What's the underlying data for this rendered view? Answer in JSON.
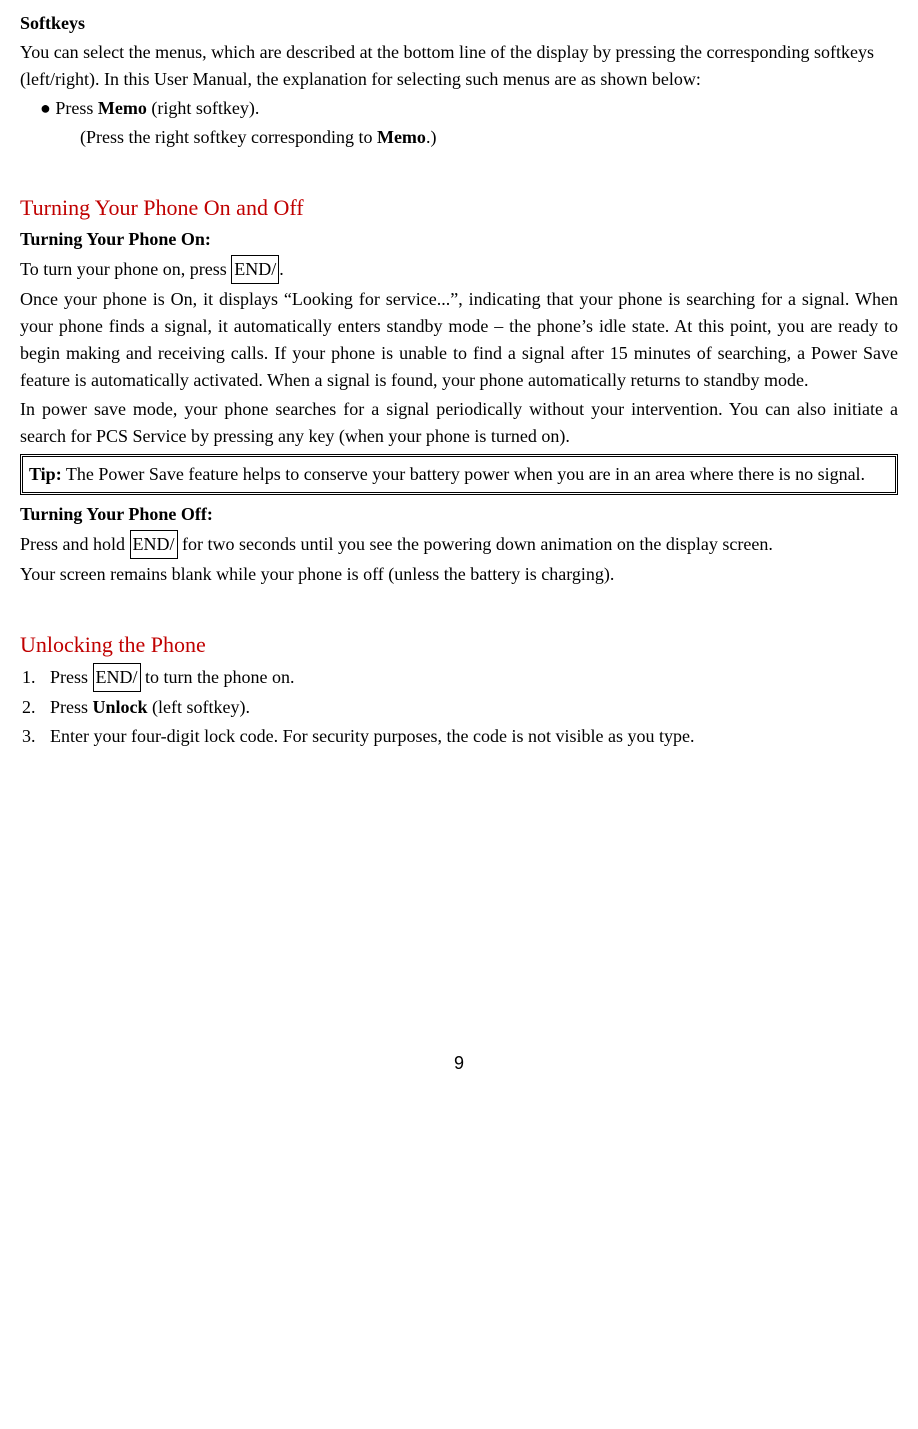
{
  "softkeys": {
    "heading": "Softkeys",
    "body": "You can select the menus, which are described at the bottom line of the display by pressing the corresponding softkeys (left/right). In this User Manual, the explanation for selecting such menus are as shown below:",
    "bullet_pre": "Press ",
    "bullet_bold": "Memo",
    "bullet_post": " (right softkey).",
    "subline_pre": "(Press the right softkey corresponding to ",
    "subline_bold": "Memo",
    "subline_post": ".)"
  },
  "turning": {
    "heading": "Turning Your Phone On and Off",
    "on_heading": "Turning Your Phone On:",
    "on_line1_pre": "To turn your phone on, press ",
    "on_line1_key": "END/",
    "on_line1_post": ".",
    "on_para1": "Once your phone is On, it displays “Looking for service...”, indicating that your phone is searching for a signal. When your phone finds a signal, it automatically enters standby mode – the phone’s idle state. At this point, you are ready to begin making and receiving calls. If your phone is unable to find a signal after 15 minutes of searching, a Power Save feature is automatically activated. When a signal is found, your phone automatically returns to standby mode.",
    "on_para2": "In power save mode, your phone searches for a signal periodically without your intervention. You can also initiate a search for PCS Service by pressing any key (when your phone is turned on).",
    "tip_bold": "Tip:",
    "tip_text": " The Power Save feature helps to conserve your battery power when you are in an area where there is no signal.",
    "off_heading": "Turning Your Phone Off:",
    "off_line1_pre": "Press and hold ",
    "off_line1_key": "END/",
    "off_line1_post": " for two seconds until you see the powering down animation on the display screen.",
    "off_line2": "Your screen remains blank while your phone is off (unless the battery is charging)."
  },
  "unlocking": {
    "heading": "Unlocking the Phone",
    "item1_pre": "Press ",
    "item1_key": "END/",
    "item1_post": " to turn the phone on.",
    "item2_pre": "Press ",
    "item2_bold": "Unlock",
    "item2_post": " (left softkey).",
    "item3": "Enter your four-digit lock code. For security purposes, the code is not visible as you type."
  },
  "page_number": "9"
}
